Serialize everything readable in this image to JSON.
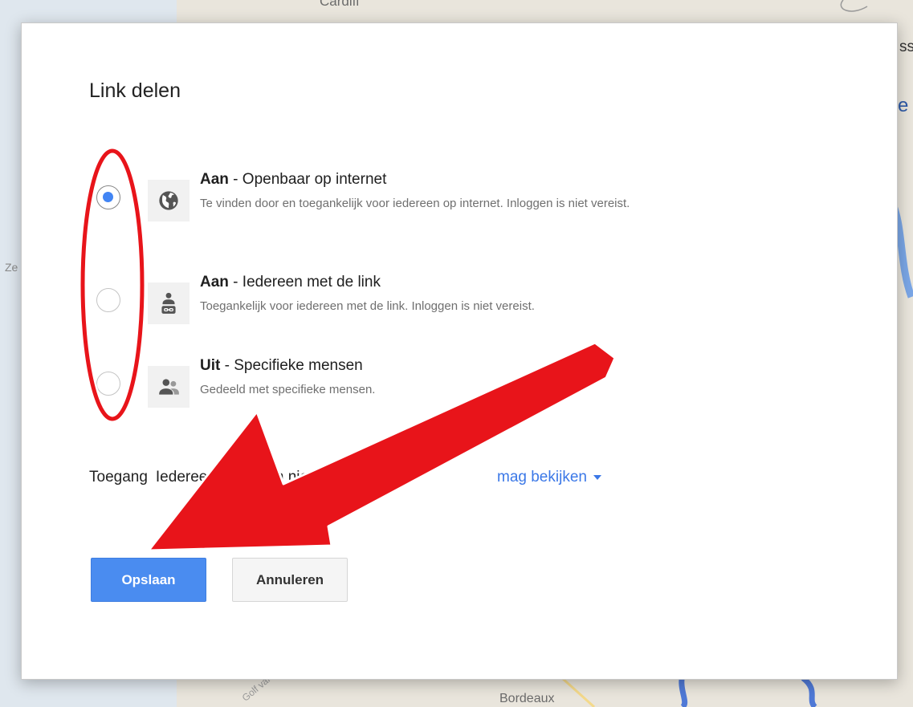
{
  "map": {
    "labels": {
      "top": "Cardiff",
      "left": "Ze",
      "bottom": "Bordeaux",
      "right_1": "ss",
      "right_2": "e",
      "diagonal": "Golf van"
    }
  },
  "dialog": {
    "title": "Link delen",
    "options": [
      {
        "strong": "Aan",
        "title": " - Openbaar op internet",
        "description": "Te vinden door en toegankelijk voor iedereen op internet. Inloggen is niet vereist.",
        "icon": "globe-icon",
        "selected": true
      },
      {
        "strong": "Aan",
        "title": " - Iedereen met de link",
        "description": "Toegankelijk voor iedereen met de link. Inloggen is niet vereist.",
        "icon": "person-link-icon",
        "selected": false
      },
      {
        "strong": "Uit",
        "title": " - Specifieke mensen",
        "description": "Gedeeld met specifieke mensen.",
        "icon": "people-icon",
        "selected": false
      }
    ],
    "access": {
      "label": "Toegang",
      "value": "Iedereen (Inloggen niet vereist)",
      "dropdown": "mag bekijken"
    },
    "buttons": {
      "save": "Opslaan",
      "cancel": "Annuleren"
    }
  },
  "colors": {
    "accent": "#4285f4",
    "link": "#3b78e7",
    "annotation": "#e8141a"
  }
}
